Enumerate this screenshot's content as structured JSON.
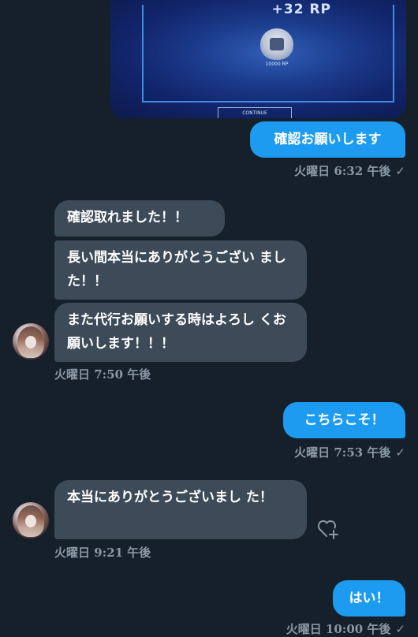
{
  "image": {
    "rp_top": "+32 RP",
    "rp_value": "10000 RP",
    "continue_label": "CONTINUE"
  },
  "messages": {
    "m1": "確認お願いします",
    "meta1": "火曜日 6:32 午後",
    "m2": "確認取れました！！",
    "m3": "長い間本当にありがとうござい ました！！",
    "m4": "また代行お願いする時はよろし くお願いします！！！",
    "meta2": "火曜日 7:50 午後",
    "m5": "こちらこそ！",
    "meta3": "火曜日 7:53 午後",
    "m6": "本当にありがとうございまし た！",
    "meta4": "火曜日 9:21 午後",
    "m7": "はい！",
    "meta5": "火曜日 10:00 午後"
  },
  "check_mark": "✓",
  "icons": {
    "avatar": "avatar",
    "react": "heart-plus-icon"
  },
  "colors": {
    "background": "#15202b",
    "outgoing_bubble": "#1d9bf0",
    "incoming_bubble": "#3d4a58",
    "meta_text": "#8b98a5"
  }
}
